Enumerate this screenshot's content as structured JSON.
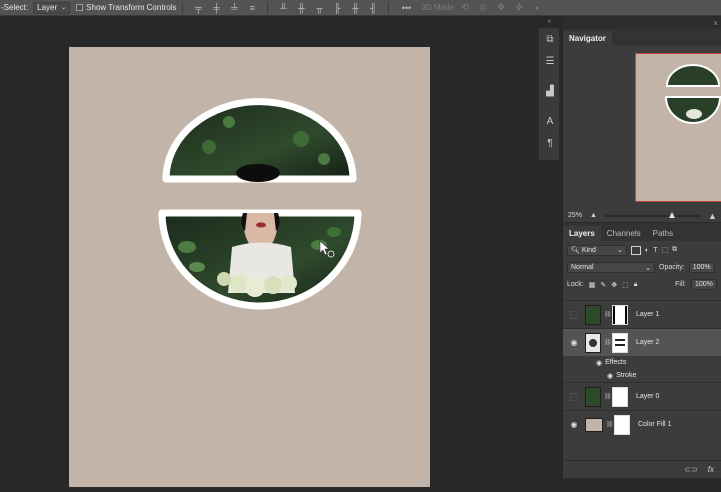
{
  "options_bar": {
    "auto_select_label": "-Select:",
    "auto_select_value": "Layer",
    "show_transform_label": "Show Transform Controls",
    "mode_3d_label": "3D Mode:",
    "more_label": "•••"
  },
  "navigator": {
    "tab_label": "Navigator",
    "zoom_value": "25%",
    "zoom_fraction": 0.67
  },
  "layers_panel": {
    "tabs": [
      "Layers",
      "Channels",
      "Paths"
    ],
    "filter_kind": "Kind",
    "blend_mode": "Normal",
    "opacity_label": "Opacity:",
    "opacity_value": "100%",
    "lock_label": "Lock:",
    "fill_label": "Fill:",
    "fill_value": "100%",
    "layers": [
      {
        "name": "Layer 1"
      },
      {
        "name": "Layer 2"
      },
      {
        "name": "Layer 0"
      },
      {
        "name": "Color Fill 1"
      }
    ],
    "effects_label": "Effects",
    "stroke_label": "Stroke",
    "fx_label": "fx"
  },
  "colors": {
    "canvas_bg": "#c3b4a9",
    "accent_outline": "#c0443c",
    "selected_layer": "#545454"
  }
}
